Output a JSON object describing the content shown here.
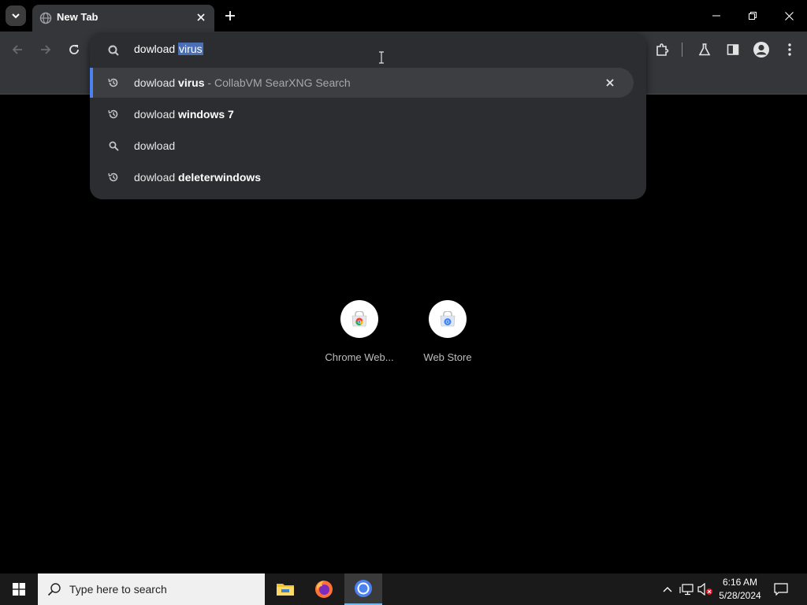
{
  "browser": {
    "tab_title": "New Tab",
    "omnibox_typed": "dowload ",
    "omnibox_autocomplete": "virus",
    "suggestions": [
      {
        "prefix": "dowload ",
        "bold": "virus",
        "separator": " - ",
        "source": "CollabVM SearXNG Search",
        "icon": "history-icon",
        "selected": true
      },
      {
        "prefix": "dowload ",
        "bold": "windows 7",
        "separator": "",
        "source": "",
        "icon": "history-icon",
        "selected": false
      },
      {
        "prefix": "dowload",
        "bold": "",
        "separator": "",
        "source": "",
        "icon": "search-icon",
        "selected": false
      },
      {
        "prefix": "dowload ",
        "bold": "deleterwindows",
        "separator": "",
        "source": "",
        "icon": "history-icon",
        "selected": false
      }
    ]
  },
  "shortcuts": [
    {
      "label": "Chrome Web...",
      "icon": "chrome-web-store-icon"
    },
    {
      "label": "Web Store",
      "icon": "web-store-icon"
    }
  ],
  "taskbar": {
    "search_placeholder": "Type here to search",
    "time": "6:16 AM",
    "date": "5/28/2024"
  },
  "colors": {
    "accent": "#4b82f0",
    "toolbar": "#35363a",
    "dropdown": "#2c2d30",
    "selection": "#4a6fb5"
  }
}
